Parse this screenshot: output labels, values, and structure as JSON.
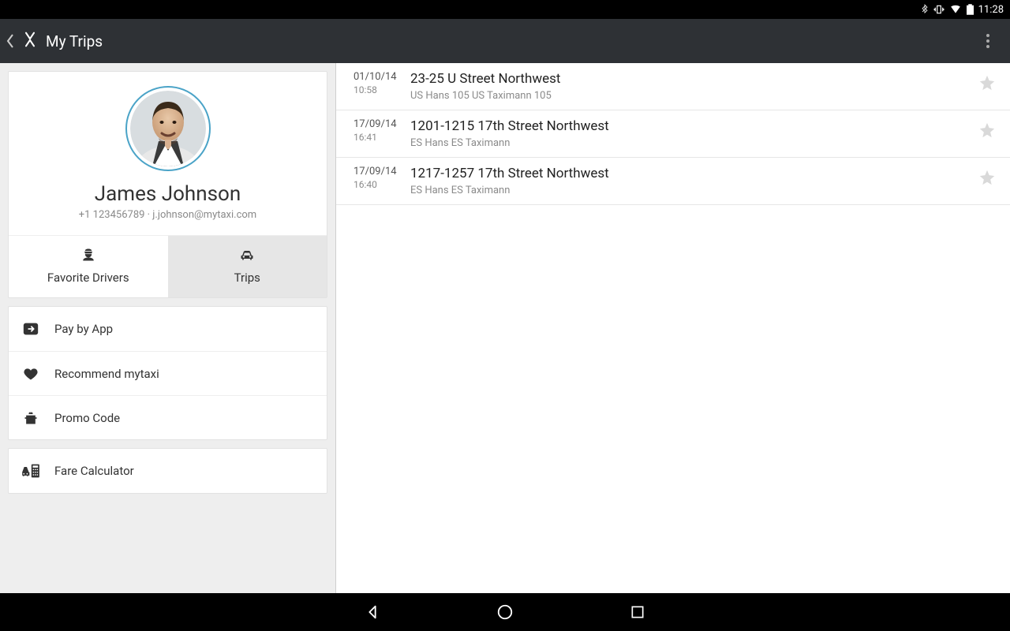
{
  "statusbar": {
    "time": "11:28"
  },
  "actionbar": {
    "title": "My Trips"
  },
  "profile": {
    "name": "James Johnson",
    "phone": "+1 123456789",
    "separator": " · ",
    "email": "j.johnson@mytaxi.com"
  },
  "tabs": {
    "favorite": "Favorite Drivers",
    "trips": "Trips"
  },
  "menu": {
    "pay": "Pay by App",
    "recommend": "Recommend mytaxi",
    "promo": "Promo Code",
    "fare": "Fare Calculator"
  },
  "trips": [
    {
      "date": "01/10/14",
      "time": "10:58",
      "address": "23-25 U Street Northwest",
      "driver": "US Hans 105 US Taximann 105"
    },
    {
      "date": "17/09/14",
      "time": "16:41",
      "address": "1201-1215 17th Street Northwest",
      "driver": "ES Hans ES Taximann"
    },
    {
      "date": "17/09/14",
      "time": "16:40",
      "address": "1217-1257 17th Street Northwest",
      "driver": "ES Hans ES Taximann"
    }
  ]
}
